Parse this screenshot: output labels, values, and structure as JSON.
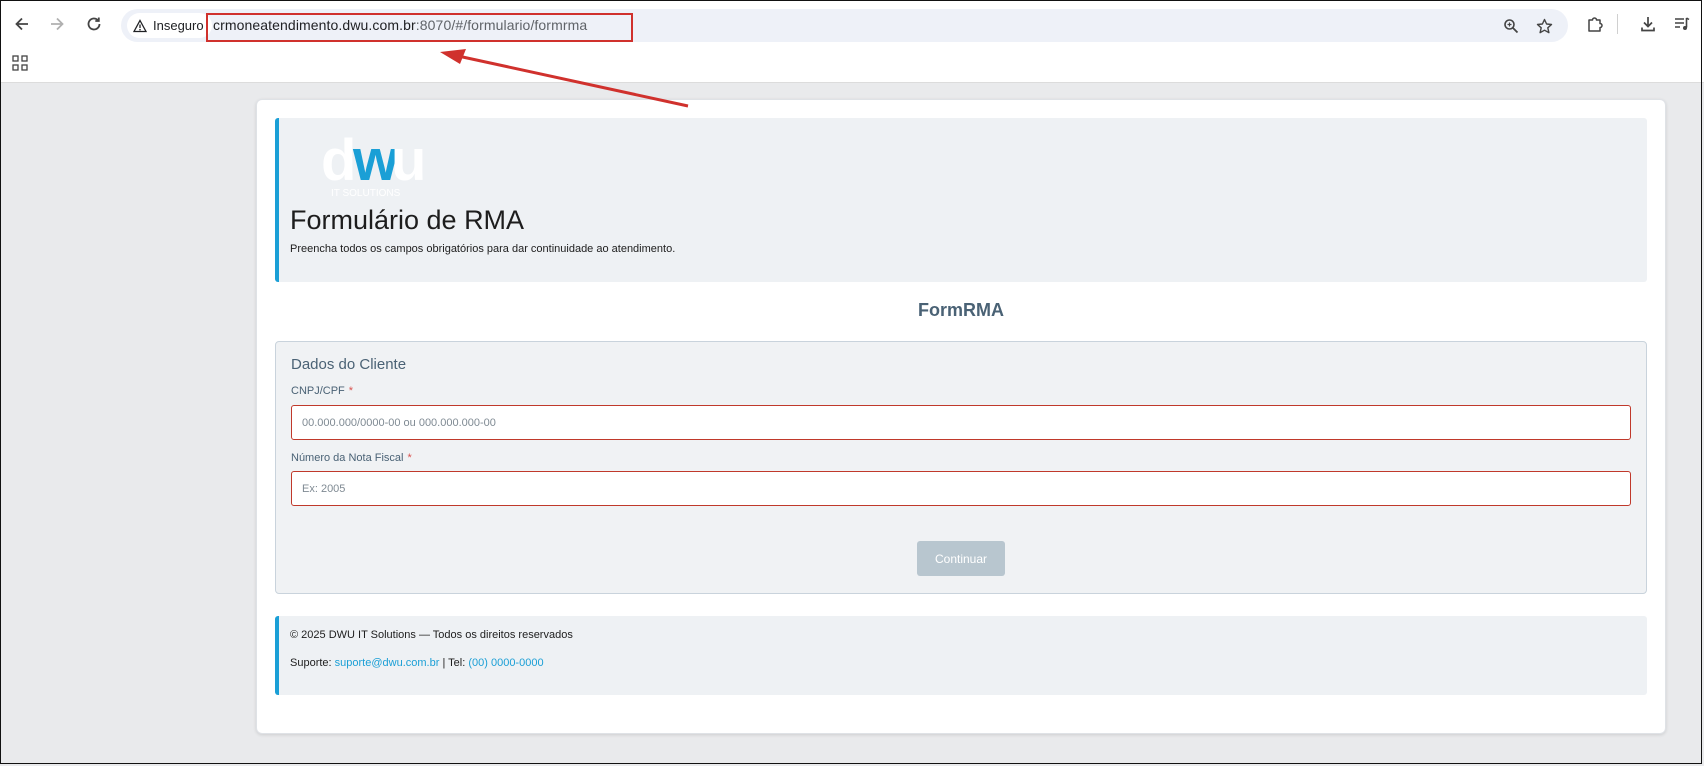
{
  "browser": {
    "security_chip_label": "Inseguro",
    "url_domain": "crmoneatendimento.dwu.com.br",
    "url_rest": ":8070/#/formulario/formrma"
  },
  "icons": {
    "back": "arrow-left-icon",
    "forward": "arrow-right-icon",
    "reload": "reload-icon",
    "warning": "warning-icon",
    "zoom": "zoom-icon",
    "bookmark": "star-icon",
    "extensions": "puzzle-icon",
    "downloads": "download-icon",
    "media": "media-controls-icon",
    "apps": "apps-grid-icon"
  },
  "colors": {
    "accent": "#1a9fd6",
    "annotation": "#d0312d",
    "error_border": "#c0392b",
    "button_disabled": "#b8c6cf"
  },
  "header": {
    "logo_text": "dwu",
    "logo_subtext": "IT SOLUTIONS",
    "title": "Formulário de RMA",
    "subtitle": "Preencha todos os campos obrigatórios para dar continuidade ao atendimento."
  },
  "form": {
    "title": "FormRMA",
    "section_legend": "Dados do Cliente",
    "fields": [
      {
        "label": "CNPJ/CPF",
        "required_mark": "*",
        "placeholder": "00.000.000/0000-00 ou 000.000.000-00",
        "value": ""
      },
      {
        "label": "Número da Nota Fiscal",
        "required_mark": "*",
        "placeholder": "Ex: 2005",
        "value": ""
      }
    ],
    "submit_label": "Continuar"
  },
  "footer": {
    "copyright": "© 2025 DWU IT Solutions — Todos os direitos reservados",
    "support_label": "Suporte:",
    "support_email": "suporte@dwu.com.br",
    "tel_label": "| Tel:",
    "tel_value": "(00) 0000-0000"
  }
}
